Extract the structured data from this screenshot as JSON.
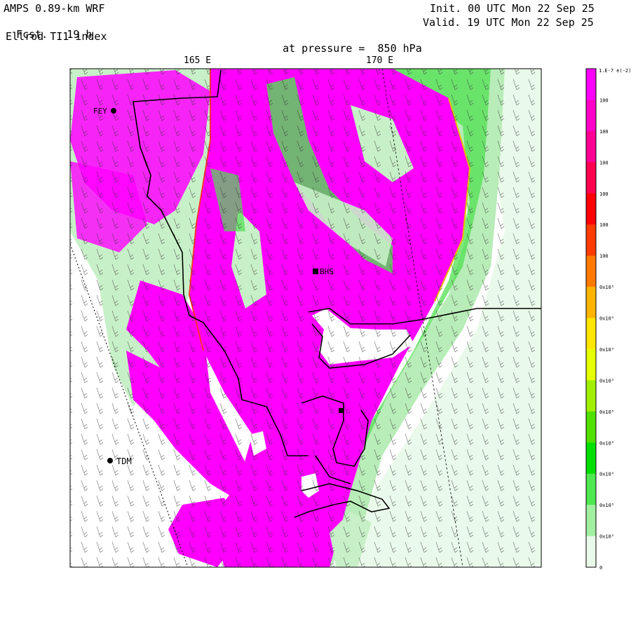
{
  "header": {
    "model": "AMPS 0.89-km WRF",
    "fcst_label": "Fcst.",
    "fcst_value": "19 h",
    "field": "Ellrod TI1 index",
    "pressure_prefix": "at pressure =",
    "pressure_value": "850 hPa",
    "init": "Init. 00 UTC Mon 22 Sep 25",
    "valid": "Valid. 19 UTC Mon 22 Sep 25"
  },
  "map": {
    "lon_labels": [
      "165 E",
      "170 E"
    ],
    "stations": [
      {
        "id": "FEY",
        "label": "FEY"
      },
      {
        "id": "BHS",
        "label": "BHS"
      },
      {
        "id": "TDM",
        "label": "TDM"
      }
    ],
    "colors": {
      "magenta": "#ff00ff",
      "light_green": "#c8f0c8",
      "green": "#50e050",
      "pale": "#eafaea"
    }
  },
  "colorbar": {
    "top_label": "1.E-7 e(-2)",
    "labels": [
      "100",
      "100",
      "100",
      "100",
      "100",
      "100",
      "0x10⁵",
      "0x10⁵",
      "0x10⁵",
      "0x10⁵",
      "0x10⁵",
      "0x10⁵",
      "0x10⁵",
      "0x10⁵",
      "0x10⁵",
      "0"
    ],
    "colors": [
      "#ff00ff",
      "#ff00c8",
      "#ff0096",
      "#ff0050",
      "#ff0000",
      "#ff3c00",
      "#ff7800",
      "#ffb400",
      "#ffe600",
      "#e6ff00",
      "#a0f000",
      "#50e000",
      "#00e000",
      "#50e850",
      "#a0f0a0",
      "#eafaea"
    ]
  }
}
